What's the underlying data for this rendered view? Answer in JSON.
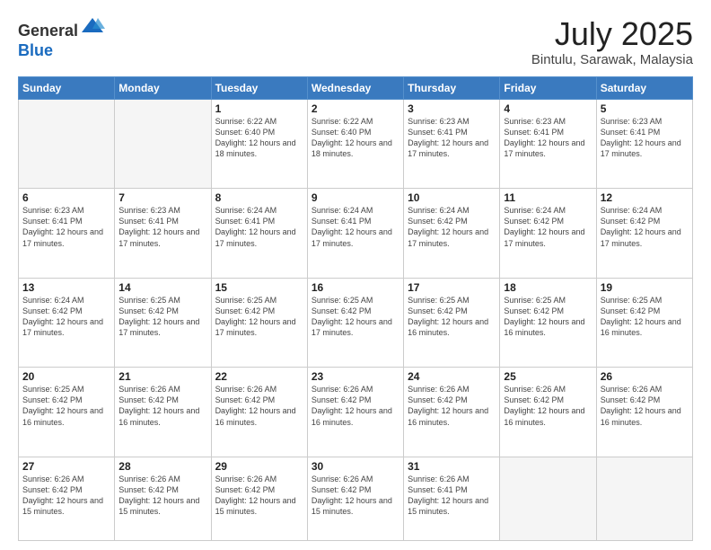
{
  "logo": {
    "general": "General",
    "blue": "Blue"
  },
  "header": {
    "month": "July 2025",
    "location": "Bintulu, Sarawak, Malaysia"
  },
  "weekdays": [
    "Sunday",
    "Monday",
    "Tuesday",
    "Wednesday",
    "Thursday",
    "Friday",
    "Saturday"
  ],
  "weeks": [
    [
      {
        "day": "",
        "empty": true
      },
      {
        "day": "",
        "empty": true
      },
      {
        "day": "1",
        "sunrise": "6:22 AM",
        "sunset": "6:40 PM",
        "daylight": "12 hours and 18 minutes."
      },
      {
        "day": "2",
        "sunrise": "6:22 AM",
        "sunset": "6:40 PM",
        "daylight": "12 hours and 18 minutes."
      },
      {
        "day": "3",
        "sunrise": "6:23 AM",
        "sunset": "6:41 PM",
        "daylight": "12 hours and 17 minutes."
      },
      {
        "day": "4",
        "sunrise": "6:23 AM",
        "sunset": "6:41 PM",
        "daylight": "12 hours and 17 minutes."
      },
      {
        "day": "5",
        "sunrise": "6:23 AM",
        "sunset": "6:41 PM",
        "daylight": "12 hours and 17 minutes."
      }
    ],
    [
      {
        "day": "6",
        "sunrise": "6:23 AM",
        "sunset": "6:41 PM",
        "daylight": "12 hours and 17 minutes."
      },
      {
        "day": "7",
        "sunrise": "6:23 AM",
        "sunset": "6:41 PM",
        "daylight": "12 hours and 17 minutes."
      },
      {
        "day": "8",
        "sunrise": "6:24 AM",
        "sunset": "6:41 PM",
        "daylight": "12 hours and 17 minutes."
      },
      {
        "day": "9",
        "sunrise": "6:24 AM",
        "sunset": "6:41 PM",
        "daylight": "12 hours and 17 minutes."
      },
      {
        "day": "10",
        "sunrise": "6:24 AM",
        "sunset": "6:42 PM",
        "daylight": "12 hours and 17 minutes."
      },
      {
        "day": "11",
        "sunrise": "6:24 AM",
        "sunset": "6:42 PM",
        "daylight": "12 hours and 17 minutes."
      },
      {
        "day": "12",
        "sunrise": "6:24 AM",
        "sunset": "6:42 PM",
        "daylight": "12 hours and 17 minutes."
      }
    ],
    [
      {
        "day": "13",
        "sunrise": "6:24 AM",
        "sunset": "6:42 PM",
        "daylight": "12 hours and 17 minutes."
      },
      {
        "day": "14",
        "sunrise": "6:25 AM",
        "sunset": "6:42 PM",
        "daylight": "12 hours and 17 minutes."
      },
      {
        "day": "15",
        "sunrise": "6:25 AM",
        "sunset": "6:42 PM",
        "daylight": "12 hours and 17 minutes."
      },
      {
        "day": "16",
        "sunrise": "6:25 AM",
        "sunset": "6:42 PM",
        "daylight": "12 hours and 17 minutes."
      },
      {
        "day": "17",
        "sunrise": "6:25 AM",
        "sunset": "6:42 PM",
        "daylight": "12 hours and 16 minutes."
      },
      {
        "day": "18",
        "sunrise": "6:25 AM",
        "sunset": "6:42 PM",
        "daylight": "12 hours and 16 minutes."
      },
      {
        "day": "19",
        "sunrise": "6:25 AM",
        "sunset": "6:42 PM",
        "daylight": "12 hours and 16 minutes."
      }
    ],
    [
      {
        "day": "20",
        "sunrise": "6:25 AM",
        "sunset": "6:42 PM",
        "daylight": "12 hours and 16 minutes."
      },
      {
        "day": "21",
        "sunrise": "6:26 AM",
        "sunset": "6:42 PM",
        "daylight": "12 hours and 16 minutes."
      },
      {
        "day": "22",
        "sunrise": "6:26 AM",
        "sunset": "6:42 PM",
        "daylight": "12 hours and 16 minutes."
      },
      {
        "day": "23",
        "sunrise": "6:26 AM",
        "sunset": "6:42 PM",
        "daylight": "12 hours and 16 minutes."
      },
      {
        "day": "24",
        "sunrise": "6:26 AM",
        "sunset": "6:42 PM",
        "daylight": "12 hours and 16 minutes."
      },
      {
        "day": "25",
        "sunrise": "6:26 AM",
        "sunset": "6:42 PM",
        "daylight": "12 hours and 16 minutes."
      },
      {
        "day": "26",
        "sunrise": "6:26 AM",
        "sunset": "6:42 PM",
        "daylight": "12 hours and 16 minutes."
      }
    ],
    [
      {
        "day": "27",
        "sunrise": "6:26 AM",
        "sunset": "6:42 PM",
        "daylight": "12 hours and 15 minutes."
      },
      {
        "day": "28",
        "sunrise": "6:26 AM",
        "sunset": "6:42 PM",
        "daylight": "12 hours and 15 minutes."
      },
      {
        "day": "29",
        "sunrise": "6:26 AM",
        "sunset": "6:42 PM",
        "daylight": "12 hours and 15 minutes."
      },
      {
        "day": "30",
        "sunrise": "6:26 AM",
        "sunset": "6:42 PM",
        "daylight": "12 hours and 15 minutes."
      },
      {
        "day": "31",
        "sunrise": "6:26 AM",
        "sunset": "6:41 PM",
        "daylight": "12 hours and 15 minutes."
      },
      {
        "day": "",
        "empty": true
      },
      {
        "day": "",
        "empty": true
      }
    ]
  ],
  "labels": {
    "sunrise": "Sunrise:",
    "sunset": "Sunset:",
    "daylight": "Daylight:"
  }
}
